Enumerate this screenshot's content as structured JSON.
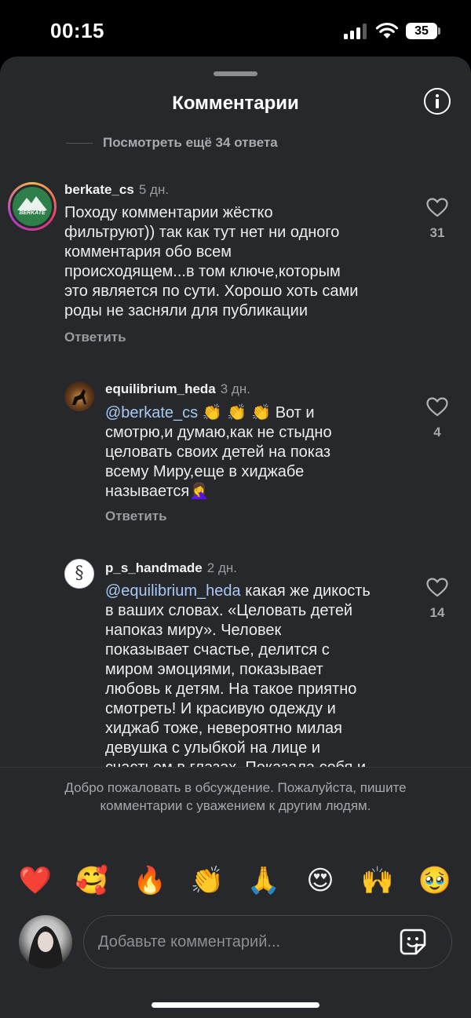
{
  "status_bar": {
    "time": "00:15",
    "battery": "35"
  },
  "sheet": {
    "title": "Комментарии",
    "view_more": "Посмотреть ещё 34 ответа",
    "reply_label": "Ответить",
    "comments": [
      {
        "username": "berkate_cs",
        "time": "5 дн.",
        "text": [
          "Походу комментарии жёстко",
          "фильтруют)) так как тут нет ни одного",
          "комментария обо всем",
          "происходящем...в том ключе,которым",
          "это является по сути. Хорошо хоть сами",
          "роды не засняли для публикации"
        ],
        "likes": "31",
        "avatar_label": "BERKATE"
      },
      {
        "username": "equilibrium_heda",
        "time": "3 дн.",
        "mention": "@berkate_cs",
        "emojis": "👏 👏 👏",
        "text_first": "Вот и",
        "text": [
          "смотрю,и думаю,как не стыдно",
          "целовать своих детей на показ",
          "всему Миру,еще в хиджабе",
          "называется🤦‍♀️"
        ],
        "likes": "4"
      },
      {
        "username": "p_s_handmade",
        "time": "2 дн.",
        "mention": "@equilibrium_heda",
        "text_first": "какая же дикость",
        "text": [
          "в ваших словах. «Целовать детей",
          "напоказ миру». Человек",
          "показывает счастье, делится с",
          "миром эмоциями, показывает",
          "любовь к детям. На такое приятно",
          "смотреть! И красивую одежду и",
          "хиджаб тоже, невероятно милая",
          "девушка с улыбкой на лице и",
          "счастьем в глазах. Показала себя и"
        ],
        "likes": "14"
      }
    ],
    "guidelines": "Добро пожаловать в обсуждение. Пожалуйста, пишите комментарии с уважением к другим людям.",
    "emojis": [
      "❤️",
      "🥰",
      "🔥",
      "👏",
      "🙏",
      "😍",
      "🙌",
      "🥹"
    ],
    "composer": {
      "placeholder": "Добавьте комментарий..."
    }
  },
  "colors": {
    "sheet_bg": "#26282c",
    "mention": "#a9c9f2",
    "muted": "#9a9ca0"
  },
  "icons": [
    "signal-icon",
    "wifi-icon",
    "info-icon",
    "heart-icon",
    "sticker-icon"
  ]
}
